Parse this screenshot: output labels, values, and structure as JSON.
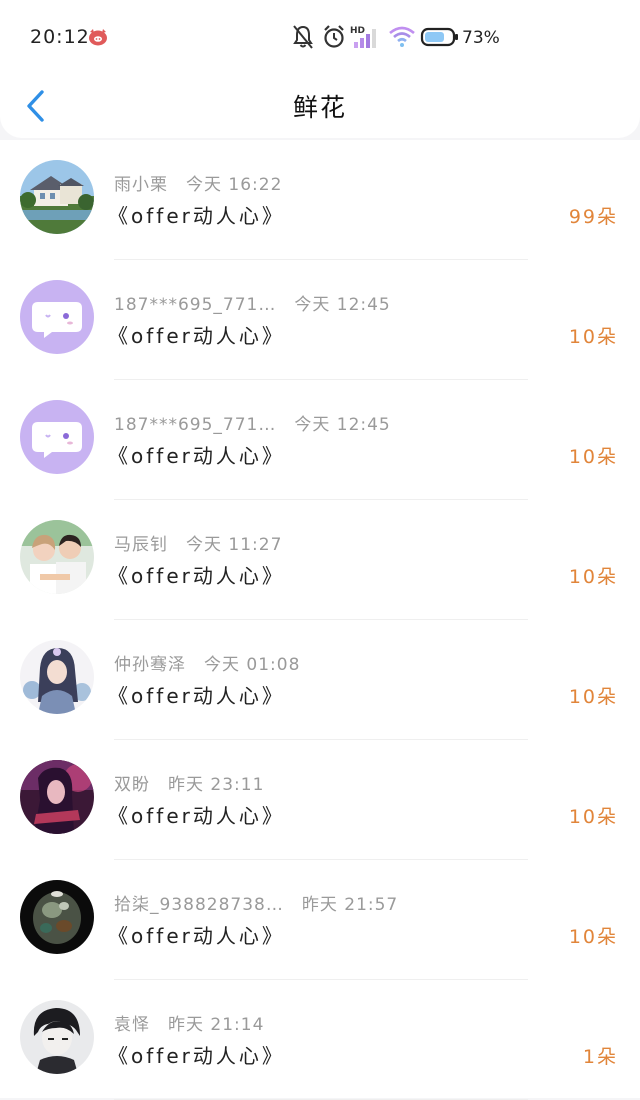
{
  "status_bar": {
    "time": "20:12",
    "hd_label": "HD",
    "battery_percent": "73%",
    "battery_level": 0.73
  },
  "header": {
    "title": "鲜花"
  },
  "colors": {
    "accent_blue": "#2f8fe6",
    "count_orange": "#e1853a",
    "secondary_text": "#9a9a9a",
    "bot_avatar_purple": "#c8b3f2"
  },
  "items": [
    {
      "name": "雨小栗",
      "time": "今天 16:22",
      "message": "《offer动人心》",
      "count": "99朵",
      "avatar": "house-photo-avatar"
    },
    {
      "name": "187***695_771…",
      "time": "今天 12:45",
      "message": "《offer动人心》",
      "count": "10朵",
      "avatar": "chat-bot-avatar"
    },
    {
      "name": "187***695_771…",
      "time": "今天 12:45",
      "message": "《offer动人心》",
      "count": "10朵",
      "avatar": "chat-bot-avatar"
    },
    {
      "name": "马辰钊",
      "time": "今天 11:27",
      "message": "《offer动人心》",
      "count": "10朵",
      "avatar": "couple-photo-avatar"
    },
    {
      "name": "仲孙骞泽",
      "time": "今天 01:08",
      "message": "《offer动人心》",
      "count": "10朵",
      "avatar": "anime-girl-avatar"
    },
    {
      "name": "双盼",
      "time": "昨天 23:11",
      "message": "《offer动人心》",
      "count": "10朵",
      "avatar": "dark-anime-avatar"
    },
    {
      "name": "拾柒_938828738…",
      "time": "昨天 21:57",
      "message": "《offer动人心》",
      "count": "10朵",
      "avatar": "crystal-photo-avatar"
    },
    {
      "name": "袁怿",
      "time": "昨天 21:14",
      "message": "《offer动人心》",
      "count": "1朵",
      "avatar": "anime-boy-avatar"
    }
  ]
}
